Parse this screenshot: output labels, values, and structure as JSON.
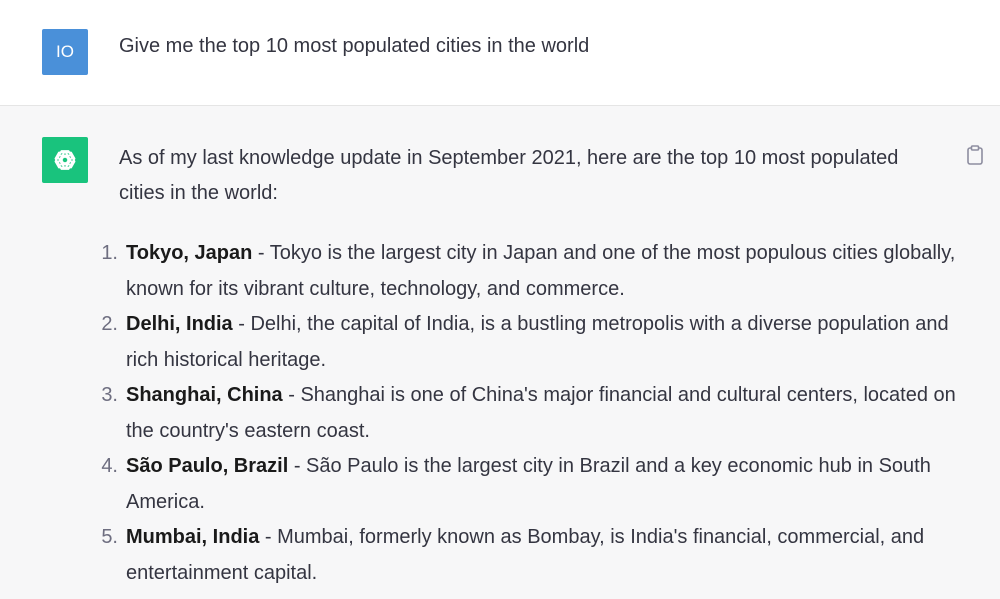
{
  "user": {
    "avatar_initials": "IO",
    "message": "Give me the top 10 most populated cities in the world"
  },
  "assistant": {
    "avatar_icon": "openai-logo-icon",
    "copy_icon": "clipboard-icon",
    "intro": "As of my last knowledge update in September 2021, here are the top 10 most populated cities in the world:",
    "items": [
      {
        "num": "1.",
        "city": "Tokyo, Japan",
        "desc": " - Tokyo is the largest city in Japan and one of the most populous cities globally, known for its vibrant culture, technology, and commerce."
      },
      {
        "num": "2.",
        "city": "Delhi, India",
        "desc": " - Delhi, the capital of India, is a bustling metropolis with a diverse population and rich historical heritage."
      },
      {
        "num": "3.",
        "city": "Shanghai, China",
        "desc": " - Shanghai is one of China's major financial and cultural centers, located on the country's eastern coast."
      },
      {
        "num": "4.",
        "city": "São Paulo, Brazil",
        "desc": " - São Paulo is the largest city in Brazil and a key economic hub in South America."
      },
      {
        "num": "5.",
        "city": "Mumbai, India",
        "desc": " - Mumbai, formerly known as Bombay, is India's financial, commercial, and entertainment capital."
      }
    ]
  },
  "colors": {
    "user_avatar": "#4a90d9",
    "bot_avatar": "#19c37d",
    "user_bg": "#ffffff",
    "assistant_bg": "#f7f7f8"
  }
}
